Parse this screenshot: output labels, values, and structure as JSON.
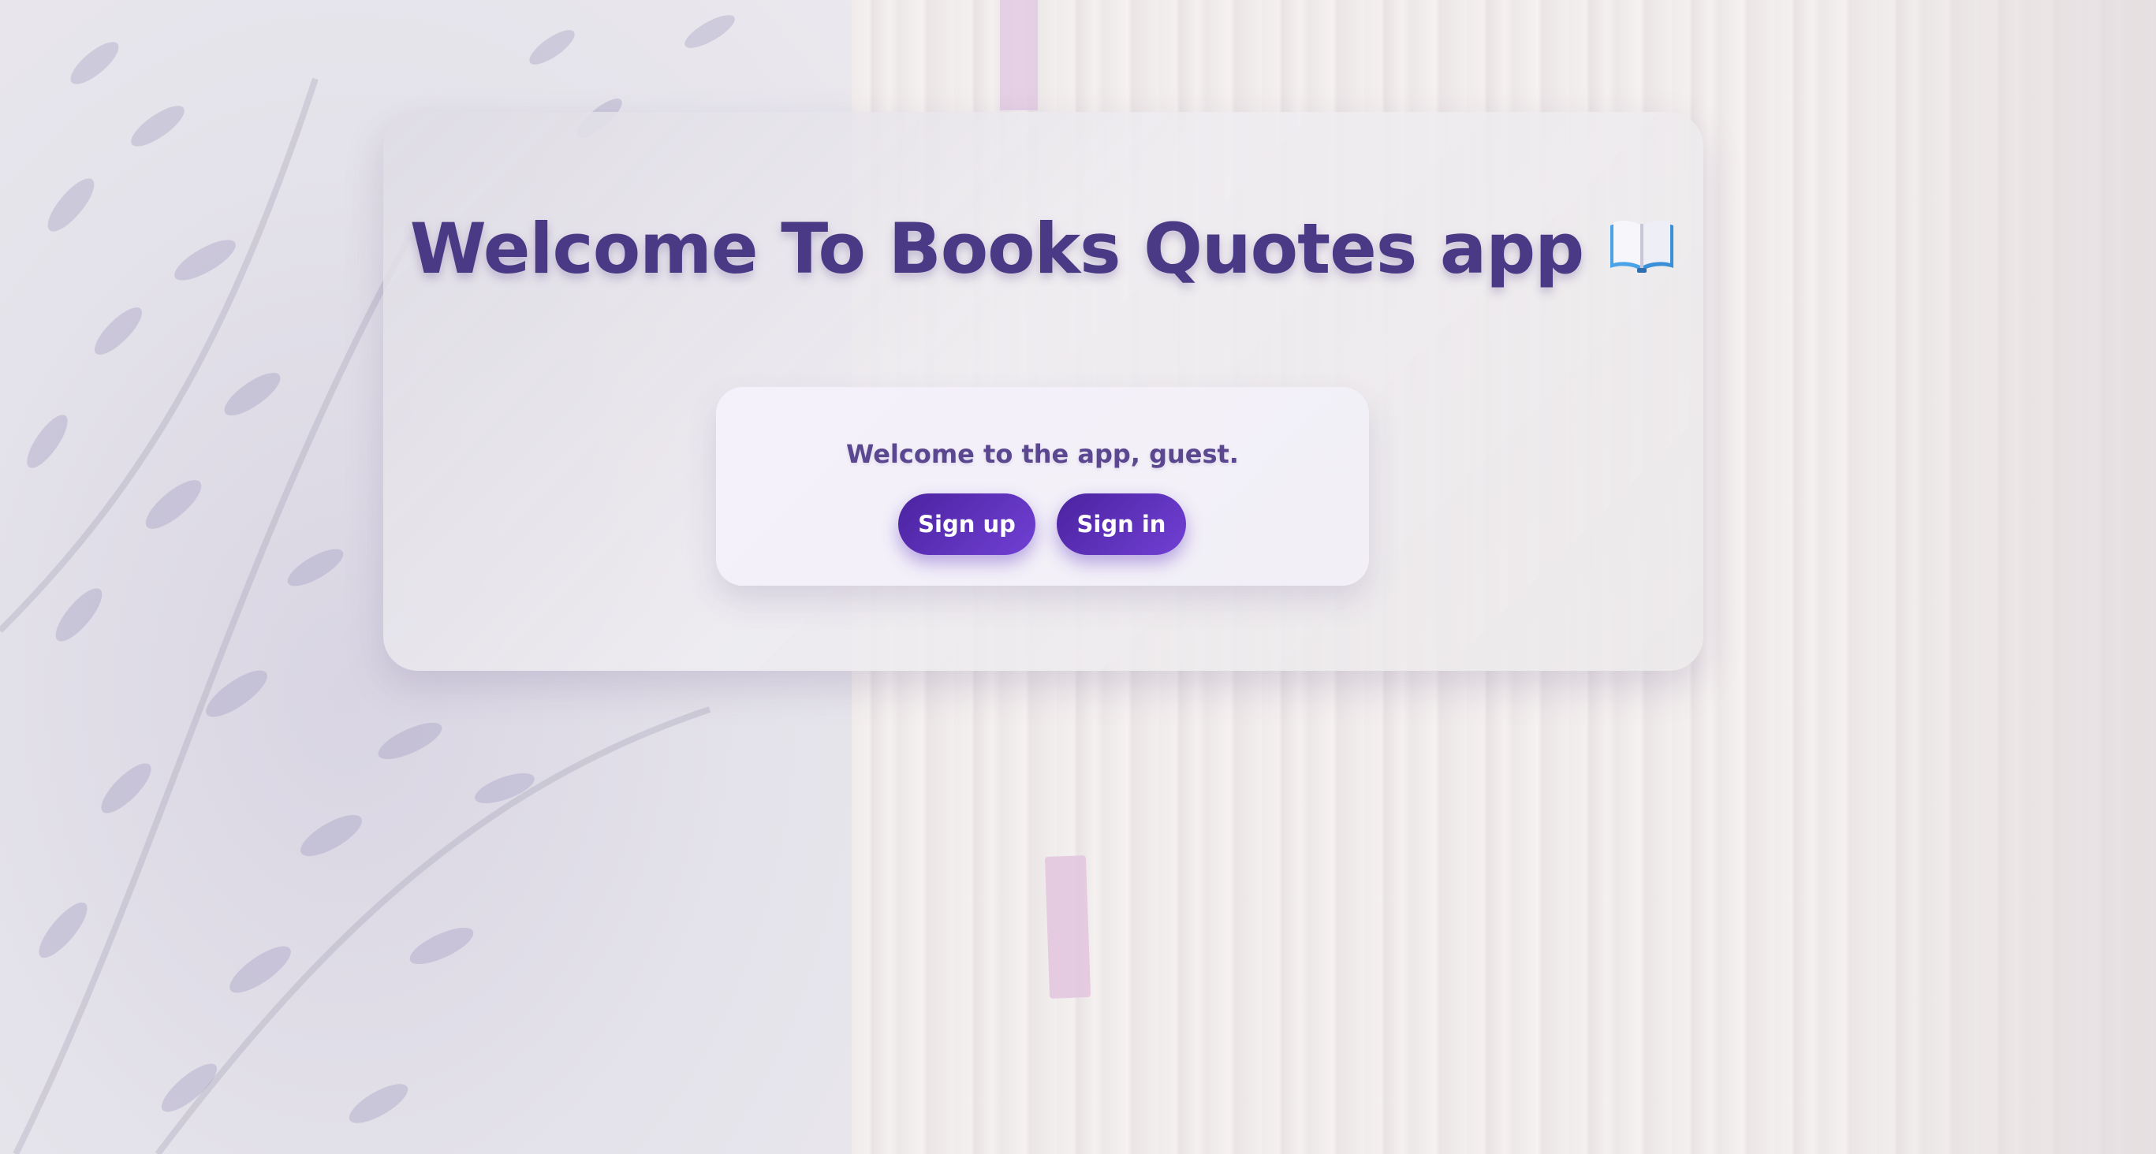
{
  "header": {
    "title": "Welcome To Books Quotes app",
    "title_icon": "open-book-icon"
  },
  "welcome": {
    "greeting": "Welcome to the app, guest.",
    "signup_label": "Sign up",
    "signin_label": "Sign in"
  },
  "theme": {
    "title_color": "#4a3a86",
    "button_gradient_start": "#4b23a0",
    "button_gradient_end": "#7140d4",
    "button_text_color": "#ffffff"
  }
}
